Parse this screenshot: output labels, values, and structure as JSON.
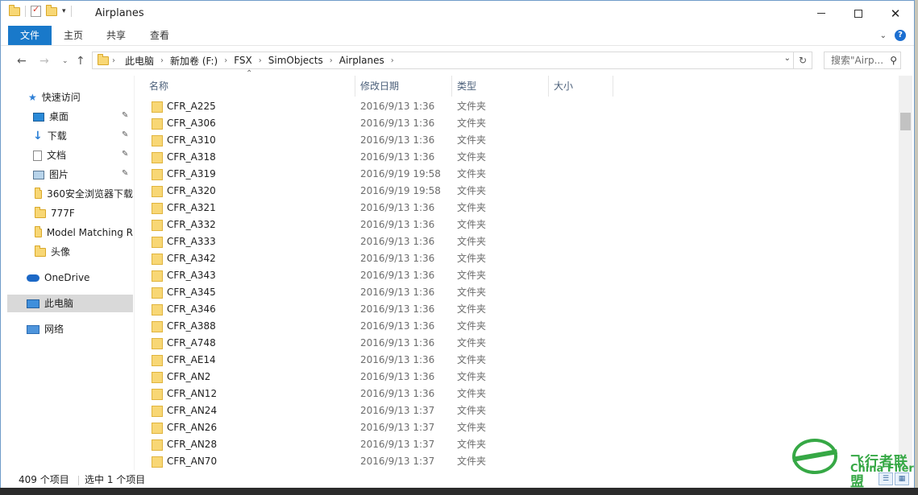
{
  "window": {
    "title": "Airplanes",
    "controls": {
      "minimize": "—",
      "maximize": "☐",
      "close": "✕"
    }
  },
  "ribbon": {
    "tabs": [
      "文件",
      "主页",
      "共享",
      "查看"
    ]
  },
  "address": {
    "crumbs": [
      "此电脑",
      "新加卷 (F:)",
      "FSX",
      "SimObjects",
      "Airplanes"
    ],
    "search_placeholder": "搜索\"Airp..."
  },
  "sidebar": {
    "quick_access": "快速访问",
    "pinned": [
      "桌面",
      "下载",
      "文档",
      "图片"
    ],
    "folders": [
      "360安全浏览器下载",
      "777F",
      "Model Matching R",
      "头像"
    ],
    "onedrive": "OneDrive",
    "this_pc": "此电脑",
    "network": "网络"
  },
  "columns": {
    "name": "名称",
    "date": "修改日期",
    "type": "类型",
    "size": "大小"
  },
  "files": [
    {
      "name": "CFR_A225",
      "date": "2016/9/13 1:36",
      "type": "文件夹"
    },
    {
      "name": "CFR_A306",
      "date": "2016/9/13 1:36",
      "type": "文件夹"
    },
    {
      "name": "CFR_A310",
      "date": "2016/9/13 1:36",
      "type": "文件夹"
    },
    {
      "name": "CFR_A318",
      "date": "2016/9/13 1:36",
      "type": "文件夹"
    },
    {
      "name": "CFR_A319",
      "date": "2016/9/19 19:58",
      "type": "文件夹"
    },
    {
      "name": "CFR_A320",
      "date": "2016/9/19 19:58",
      "type": "文件夹"
    },
    {
      "name": "CFR_A321",
      "date": "2016/9/13 1:36",
      "type": "文件夹"
    },
    {
      "name": "CFR_A332",
      "date": "2016/9/13 1:36",
      "type": "文件夹"
    },
    {
      "name": "CFR_A333",
      "date": "2016/9/13 1:36",
      "type": "文件夹"
    },
    {
      "name": "CFR_A342",
      "date": "2016/9/13 1:36",
      "type": "文件夹"
    },
    {
      "name": "CFR_A343",
      "date": "2016/9/13 1:36",
      "type": "文件夹"
    },
    {
      "name": "CFR_A345",
      "date": "2016/9/13 1:36",
      "type": "文件夹"
    },
    {
      "name": "CFR_A346",
      "date": "2016/9/13 1:36",
      "type": "文件夹"
    },
    {
      "name": "CFR_A388",
      "date": "2016/9/13 1:36",
      "type": "文件夹"
    },
    {
      "name": "CFR_A748",
      "date": "2016/9/13 1:36",
      "type": "文件夹"
    },
    {
      "name": "CFR_AE14",
      "date": "2016/9/13 1:36",
      "type": "文件夹"
    },
    {
      "name": "CFR_AN2",
      "date": "2016/9/13 1:36",
      "type": "文件夹"
    },
    {
      "name": "CFR_AN12",
      "date": "2016/9/13 1:36",
      "type": "文件夹"
    },
    {
      "name": "CFR_AN24",
      "date": "2016/9/13 1:37",
      "type": "文件夹"
    },
    {
      "name": "CFR_AN26",
      "date": "2016/9/13 1:37",
      "type": "文件夹"
    },
    {
      "name": "CFR_AN28",
      "date": "2016/9/13 1:37",
      "type": "文件夹"
    },
    {
      "name": "CFR_AN70",
      "date": "2016/9/13 1:37",
      "type": "文件夹"
    }
  ],
  "status": {
    "count": "409 个项目",
    "selected": "选中 1 个项目"
  },
  "watermark": {
    "cn": "飞行者联盟",
    "en": "China Flier"
  }
}
